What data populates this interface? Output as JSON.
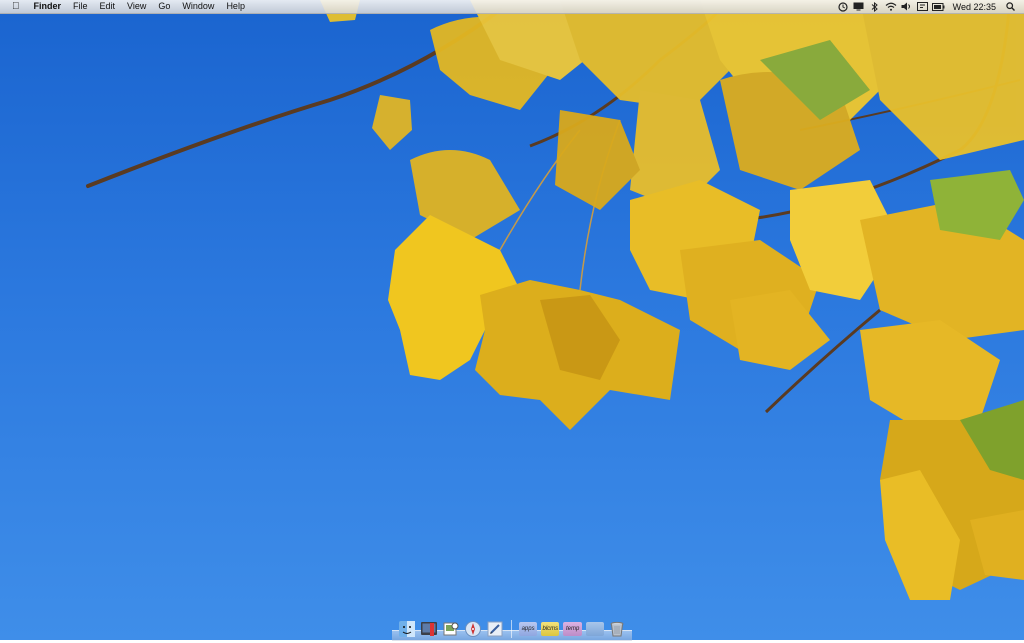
{
  "menubar": {
    "apple_symbol": "",
    "app_name": "Finder",
    "menus": [
      "File",
      "Edit",
      "View",
      "Go",
      "Window",
      "Help"
    ],
    "status_icons": [
      "time-machine-icon",
      "display-icon",
      "bluetooth-icon",
      "wifi-icon",
      "volume-icon",
      "input-icon",
      "battery-icon"
    ],
    "clock": "Wed 22:35"
  },
  "dock": {
    "apps": [
      "finder-icon",
      "system-preferences-icon",
      "preview-icon",
      "safari-icon",
      "textedit-icon"
    ],
    "folders": [
      {
        "label": "apps",
        "color": "#9fb5e8"
      },
      {
        "label": "blcms",
        "color": "#e8d65a"
      },
      {
        "label": "temp",
        "color": "#c89ad0"
      },
      {
        "label": "",
        "color": "#a9c6ea"
      }
    ],
    "trash": "trash-icon"
  },
  "colors": {
    "sky_top": "#1a64cf",
    "sky_bottom": "#3f8ee9",
    "leaf_yellow": "#f0c419",
    "leaf_orange": "#d99a14",
    "branch": "#5a3b22"
  }
}
